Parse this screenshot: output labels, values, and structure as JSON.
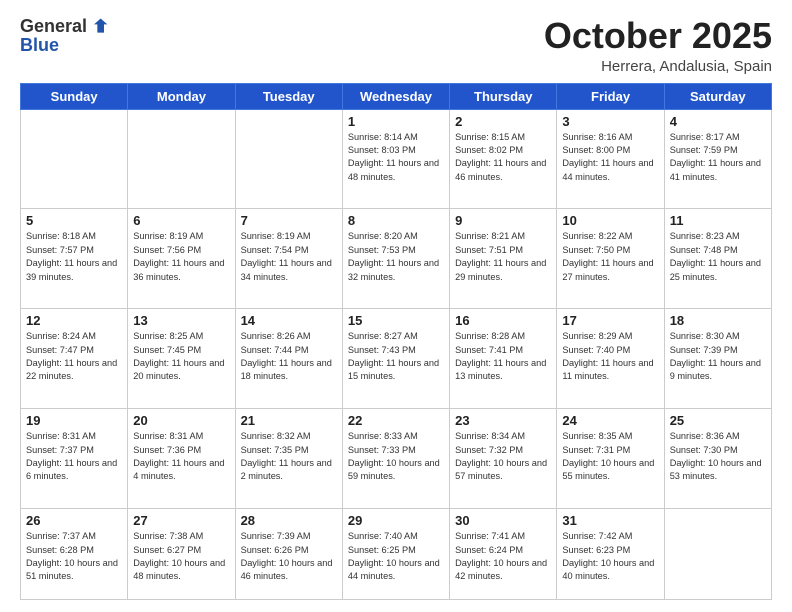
{
  "header": {
    "logo_general": "General",
    "logo_blue": "Blue",
    "month": "October 2025",
    "location": "Herrera, Andalusia, Spain"
  },
  "days_of_week": [
    "Sunday",
    "Monday",
    "Tuesday",
    "Wednesday",
    "Thursday",
    "Friday",
    "Saturday"
  ],
  "weeks": [
    [
      {
        "day": "",
        "sunrise": "",
        "sunset": "",
        "daylight": ""
      },
      {
        "day": "",
        "sunrise": "",
        "sunset": "",
        "daylight": ""
      },
      {
        "day": "",
        "sunrise": "",
        "sunset": "",
        "daylight": ""
      },
      {
        "day": "1",
        "sunrise": "Sunrise: 8:14 AM",
        "sunset": "Sunset: 8:03 PM",
        "daylight": "Daylight: 11 hours and 48 minutes."
      },
      {
        "day": "2",
        "sunrise": "Sunrise: 8:15 AM",
        "sunset": "Sunset: 8:02 PM",
        "daylight": "Daylight: 11 hours and 46 minutes."
      },
      {
        "day": "3",
        "sunrise": "Sunrise: 8:16 AM",
        "sunset": "Sunset: 8:00 PM",
        "daylight": "Daylight: 11 hours and 44 minutes."
      },
      {
        "day": "4",
        "sunrise": "Sunrise: 8:17 AM",
        "sunset": "Sunset: 7:59 PM",
        "daylight": "Daylight: 11 hours and 41 minutes."
      }
    ],
    [
      {
        "day": "5",
        "sunrise": "Sunrise: 8:18 AM",
        "sunset": "Sunset: 7:57 PM",
        "daylight": "Daylight: 11 hours and 39 minutes."
      },
      {
        "day": "6",
        "sunrise": "Sunrise: 8:19 AM",
        "sunset": "Sunset: 7:56 PM",
        "daylight": "Daylight: 11 hours and 36 minutes."
      },
      {
        "day": "7",
        "sunrise": "Sunrise: 8:19 AM",
        "sunset": "Sunset: 7:54 PM",
        "daylight": "Daylight: 11 hours and 34 minutes."
      },
      {
        "day": "8",
        "sunrise": "Sunrise: 8:20 AM",
        "sunset": "Sunset: 7:53 PM",
        "daylight": "Daylight: 11 hours and 32 minutes."
      },
      {
        "day": "9",
        "sunrise": "Sunrise: 8:21 AM",
        "sunset": "Sunset: 7:51 PM",
        "daylight": "Daylight: 11 hours and 29 minutes."
      },
      {
        "day": "10",
        "sunrise": "Sunrise: 8:22 AM",
        "sunset": "Sunset: 7:50 PM",
        "daylight": "Daylight: 11 hours and 27 minutes."
      },
      {
        "day": "11",
        "sunrise": "Sunrise: 8:23 AM",
        "sunset": "Sunset: 7:48 PM",
        "daylight": "Daylight: 11 hours and 25 minutes."
      }
    ],
    [
      {
        "day": "12",
        "sunrise": "Sunrise: 8:24 AM",
        "sunset": "Sunset: 7:47 PM",
        "daylight": "Daylight: 11 hours and 22 minutes."
      },
      {
        "day": "13",
        "sunrise": "Sunrise: 8:25 AM",
        "sunset": "Sunset: 7:45 PM",
        "daylight": "Daylight: 11 hours and 20 minutes."
      },
      {
        "day": "14",
        "sunrise": "Sunrise: 8:26 AM",
        "sunset": "Sunset: 7:44 PM",
        "daylight": "Daylight: 11 hours and 18 minutes."
      },
      {
        "day": "15",
        "sunrise": "Sunrise: 8:27 AM",
        "sunset": "Sunset: 7:43 PM",
        "daylight": "Daylight: 11 hours and 15 minutes."
      },
      {
        "day": "16",
        "sunrise": "Sunrise: 8:28 AM",
        "sunset": "Sunset: 7:41 PM",
        "daylight": "Daylight: 11 hours and 13 minutes."
      },
      {
        "day": "17",
        "sunrise": "Sunrise: 8:29 AM",
        "sunset": "Sunset: 7:40 PM",
        "daylight": "Daylight: 11 hours and 11 minutes."
      },
      {
        "day": "18",
        "sunrise": "Sunrise: 8:30 AM",
        "sunset": "Sunset: 7:39 PM",
        "daylight": "Daylight: 11 hours and 9 minutes."
      }
    ],
    [
      {
        "day": "19",
        "sunrise": "Sunrise: 8:31 AM",
        "sunset": "Sunset: 7:37 PM",
        "daylight": "Daylight: 11 hours and 6 minutes."
      },
      {
        "day": "20",
        "sunrise": "Sunrise: 8:31 AM",
        "sunset": "Sunset: 7:36 PM",
        "daylight": "Daylight: 11 hours and 4 minutes."
      },
      {
        "day": "21",
        "sunrise": "Sunrise: 8:32 AM",
        "sunset": "Sunset: 7:35 PM",
        "daylight": "Daylight: 11 hours and 2 minutes."
      },
      {
        "day": "22",
        "sunrise": "Sunrise: 8:33 AM",
        "sunset": "Sunset: 7:33 PM",
        "daylight": "Daylight: 10 hours and 59 minutes."
      },
      {
        "day": "23",
        "sunrise": "Sunrise: 8:34 AM",
        "sunset": "Sunset: 7:32 PM",
        "daylight": "Daylight: 10 hours and 57 minutes."
      },
      {
        "day": "24",
        "sunrise": "Sunrise: 8:35 AM",
        "sunset": "Sunset: 7:31 PM",
        "daylight": "Daylight: 10 hours and 55 minutes."
      },
      {
        "day": "25",
        "sunrise": "Sunrise: 8:36 AM",
        "sunset": "Sunset: 7:30 PM",
        "daylight": "Daylight: 10 hours and 53 minutes."
      }
    ],
    [
      {
        "day": "26",
        "sunrise": "Sunrise: 7:37 AM",
        "sunset": "Sunset: 6:28 PM",
        "daylight": "Daylight: 10 hours and 51 minutes."
      },
      {
        "day": "27",
        "sunrise": "Sunrise: 7:38 AM",
        "sunset": "Sunset: 6:27 PM",
        "daylight": "Daylight: 10 hours and 48 minutes."
      },
      {
        "day": "28",
        "sunrise": "Sunrise: 7:39 AM",
        "sunset": "Sunset: 6:26 PM",
        "daylight": "Daylight: 10 hours and 46 minutes."
      },
      {
        "day": "29",
        "sunrise": "Sunrise: 7:40 AM",
        "sunset": "Sunset: 6:25 PM",
        "daylight": "Daylight: 10 hours and 44 minutes."
      },
      {
        "day": "30",
        "sunrise": "Sunrise: 7:41 AM",
        "sunset": "Sunset: 6:24 PM",
        "daylight": "Daylight: 10 hours and 42 minutes."
      },
      {
        "day": "31",
        "sunrise": "Sunrise: 7:42 AM",
        "sunset": "Sunset: 6:23 PM",
        "daylight": "Daylight: 10 hours and 40 minutes."
      },
      {
        "day": "",
        "sunrise": "",
        "sunset": "",
        "daylight": ""
      }
    ]
  ]
}
